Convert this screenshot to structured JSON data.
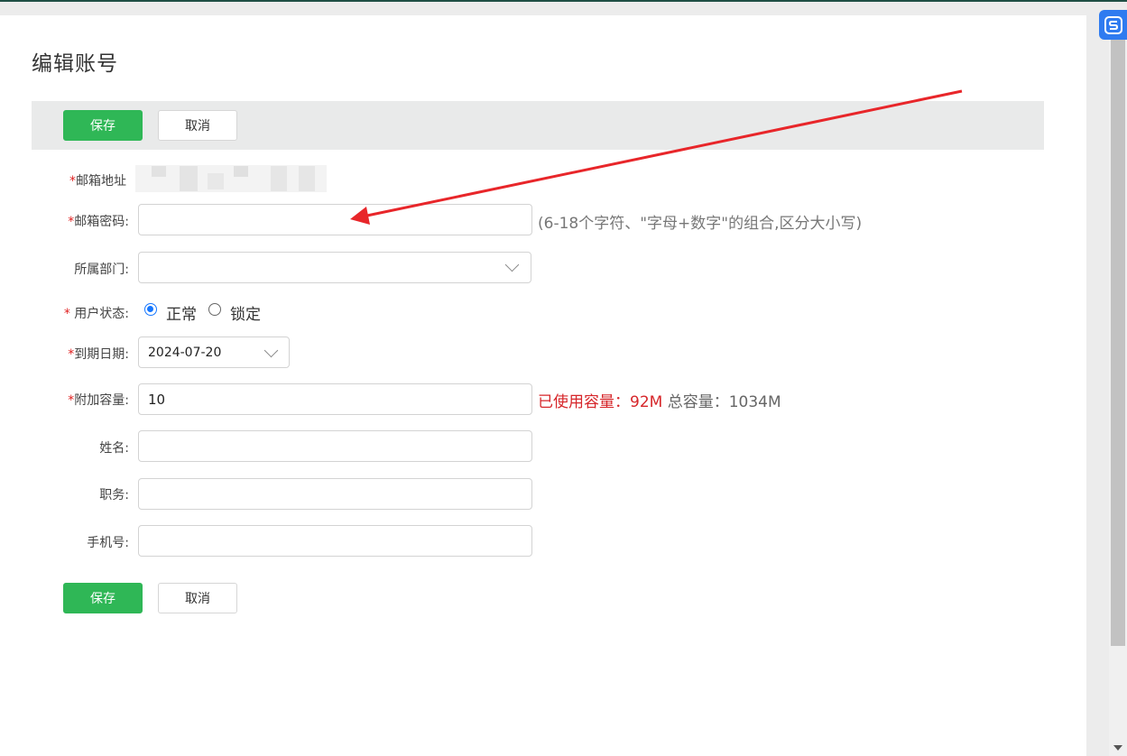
{
  "page": {
    "title": "编辑账号"
  },
  "toolbar": {
    "save_label": "保存",
    "cancel_label": "取消"
  },
  "form": {
    "email_address": {
      "required_mark": "*",
      "label": "邮箱地址"
    },
    "email_password": {
      "required_mark": "*",
      "label": "邮箱密码:",
      "value": "",
      "hint": "(6-18个字符、\"字母+数字\"的组合,区分大小写)"
    },
    "department": {
      "label": "所属部门:",
      "value": ""
    },
    "user_status": {
      "required_mark": "*",
      "label": " 用户状态:",
      "options": [
        {
          "label": "正常",
          "selected": true
        },
        {
          "label": "锁定",
          "selected": false
        }
      ]
    },
    "expiry_date": {
      "required_mark": "*",
      "label": "到期日期:",
      "value": "2024-07-20"
    },
    "extra_capacity": {
      "required_mark": "*",
      "label": "附加容量:",
      "value": "10",
      "used_text": "已使用容量：92M",
      "total_text": "总容量：1034M"
    },
    "name": {
      "label": "姓名:",
      "value": ""
    },
    "position": {
      "label": "职务:",
      "value": ""
    },
    "phone": {
      "label": "手机号:",
      "value": ""
    }
  },
  "footer": {
    "save_label": "保存",
    "cancel_label": "取消"
  },
  "colors": {
    "save_button": "#2fb756",
    "required": "#e02020",
    "annotation_arrow": "#e8262a",
    "used_capacity": "#d6262a",
    "radio_selected": "#1677ff"
  },
  "icons": {
    "dropdown": "chevron-down-icon",
    "floating_badge": "s-logo-icon"
  }
}
